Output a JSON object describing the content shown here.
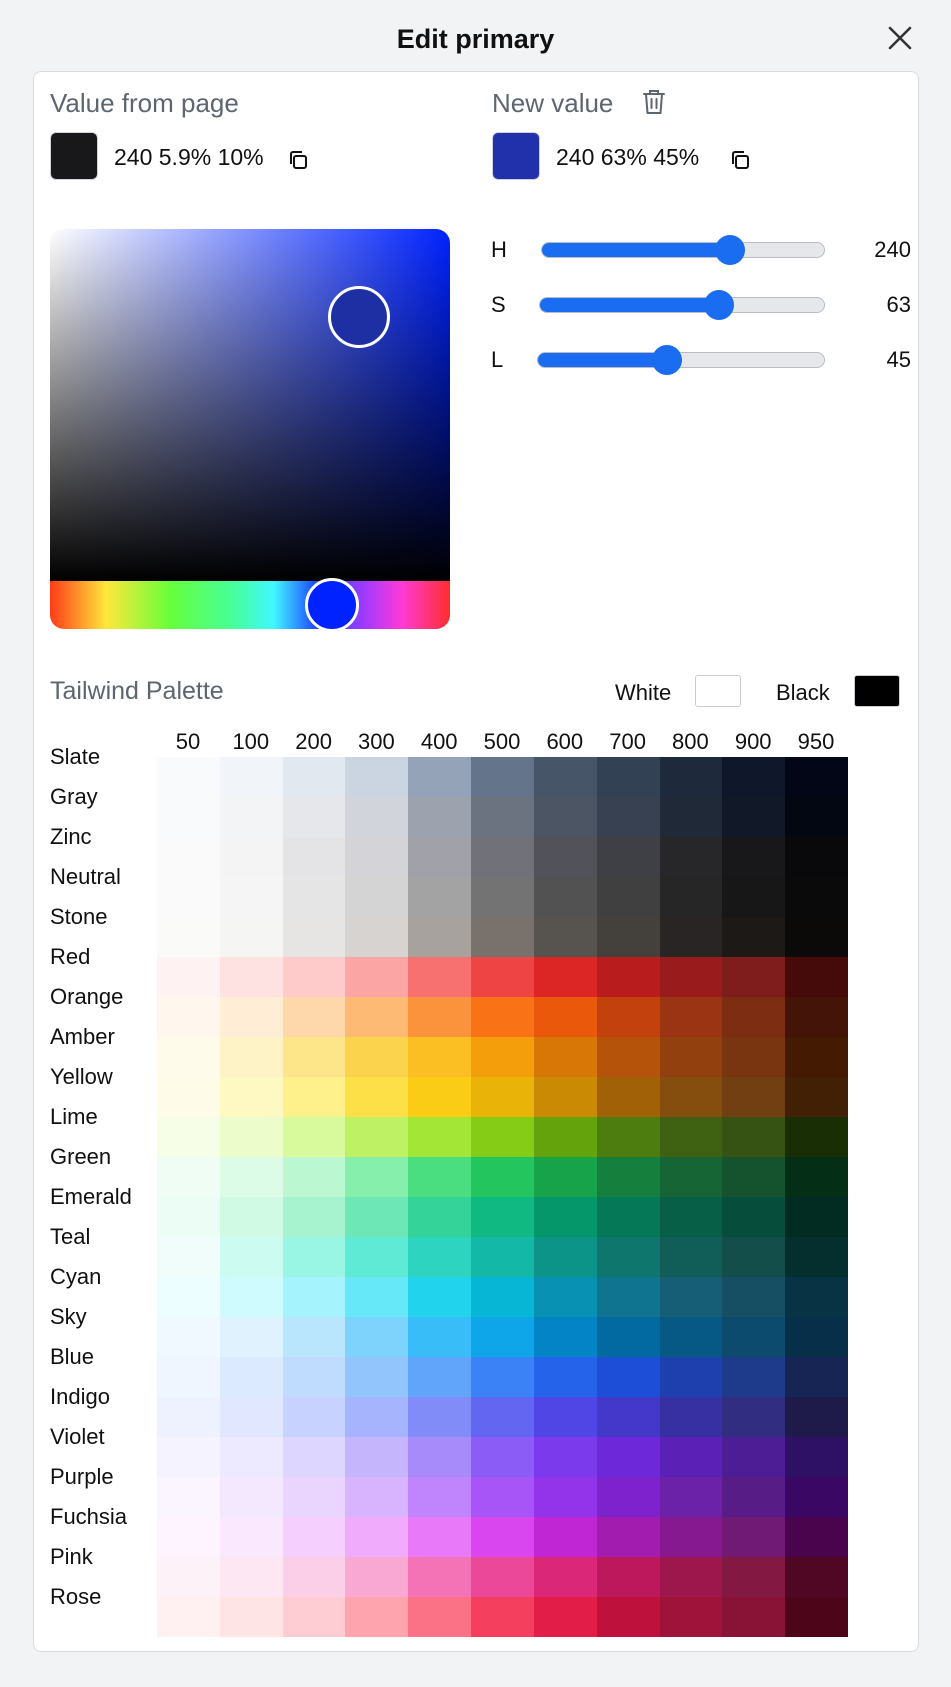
{
  "header": {
    "title": "Edit primary"
  },
  "from_page": {
    "label": "Value from page",
    "value": "240 5.9% 10%",
    "swatch": "#18181b"
  },
  "new_value": {
    "label": "New value",
    "value": "240 63% 45%",
    "swatch": "#2130ab"
  },
  "sliders": [
    {
      "letter": "H",
      "value": "240",
      "fraction": 0.667
    },
    {
      "letter": "S",
      "value": "63",
      "fraction": 0.63
    },
    {
      "letter": "L",
      "value": "45",
      "fraction": 0.45
    }
  ],
  "palette": {
    "title": "Tailwind Palette",
    "white_label": "White",
    "black_label": "Black",
    "white_color": "#ffffff",
    "black_color": "#000000",
    "shades": [
      "50",
      "100",
      "200",
      "300",
      "400",
      "500",
      "600",
      "700",
      "800",
      "900",
      "950"
    ],
    "rows": [
      {
        "name": "Slate",
        "colors": [
          "#f8fafc",
          "#f1f5f9",
          "#e2e8f0",
          "#cbd5e1",
          "#94a3b8",
          "#64748b",
          "#475569",
          "#334155",
          "#1e293b",
          "#0f172a",
          "#020617"
        ]
      },
      {
        "name": "Gray",
        "colors": [
          "#f9fafb",
          "#f3f4f6",
          "#e5e7eb",
          "#d1d5db",
          "#9ca3af",
          "#6b7280",
          "#4b5563",
          "#374151",
          "#1f2937",
          "#111827",
          "#030712"
        ]
      },
      {
        "name": "Zinc",
        "colors": [
          "#fafafa",
          "#f4f4f5",
          "#e4e4e7",
          "#d4d4d8",
          "#a1a1aa",
          "#71717a",
          "#52525b",
          "#3f3f46",
          "#27272a",
          "#18181b",
          "#09090b"
        ]
      },
      {
        "name": "Neutral",
        "colors": [
          "#fafafa",
          "#f5f5f5",
          "#e5e5e5",
          "#d4d4d4",
          "#a3a3a3",
          "#737373",
          "#525252",
          "#404040",
          "#262626",
          "#171717",
          "#0a0a0a"
        ]
      },
      {
        "name": "Stone",
        "colors": [
          "#fafaf9",
          "#f5f5f4",
          "#e7e5e4",
          "#d6d3d1",
          "#a8a29e",
          "#78716c",
          "#57534e",
          "#44403c",
          "#292524",
          "#1c1917",
          "#0c0a09"
        ]
      },
      {
        "name": "Red",
        "colors": [
          "#fef2f2",
          "#fee2e2",
          "#fecaca",
          "#fca5a5",
          "#f87171",
          "#ef4444",
          "#dc2626",
          "#b91c1c",
          "#991b1b",
          "#7f1d1d",
          "#450a0a"
        ]
      },
      {
        "name": "Orange",
        "colors": [
          "#fff7ed",
          "#ffedd5",
          "#fed7aa",
          "#fdba74",
          "#fb923c",
          "#f97316",
          "#ea580c",
          "#c2410c",
          "#9a3412",
          "#7c2d12",
          "#431407"
        ]
      },
      {
        "name": "Amber",
        "colors": [
          "#fffbeb",
          "#fef3c7",
          "#fde68a",
          "#fcd34d",
          "#fbbf24",
          "#f59e0b",
          "#d97706",
          "#b45309",
          "#92400e",
          "#78350f",
          "#451a03"
        ]
      },
      {
        "name": "Yellow",
        "colors": [
          "#fefce8",
          "#fef9c3",
          "#fef08a",
          "#fde047",
          "#facc15",
          "#eab308",
          "#ca8a04",
          "#a16207",
          "#854d0e",
          "#713f12",
          "#422006"
        ]
      },
      {
        "name": "Lime",
        "colors": [
          "#f7fee7",
          "#ecfccb",
          "#d9f99d",
          "#bef264",
          "#a3e635",
          "#84cc16",
          "#65a30d",
          "#4d7c0f",
          "#3f6212",
          "#365314",
          "#1a2e05"
        ]
      },
      {
        "name": "Green",
        "colors": [
          "#f0fdf4",
          "#dcfce7",
          "#bbf7d0",
          "#86efac",
          "#4ade80",
          "#22c55e",
          "#16a34a",
          "#15803d",
          "#166534",
          "#14532d",
          "#052e16"
        ]
      },
      {
        "name": "Emerald",
        "colors": [
          "#ecfdf5",
          "#d1fae5",
          "#a7f3d0",
          "#6ee7b7",
          "#34d399",
          "#10b981",
          "#059669",
          "#047857",
          "#065f46",
          "#064e3b",
          "#022c22"
        ]
      },
      {
        "name": "Teal",
        "colors": [
          "#f0fdfa",
          "#ccfbf1",
          "#99f6e4",
          "#5eead4",
          "#2dd4bf",
          "#14b8a6",
          "#0d9488",
          "#0f766e",
          "#115e59",
          "#134e4a",
          "#042f2e"
        ]
      },
      {
        "name": "Cyan",
        "colors": [
          "#ecfeff",
          "#cffafe",
          "#a5f3fc",
          "#67e8f9",
          "#22d3ee",
          "#06b6d4",
          "#0891b2",
          "#0e7490",
          "#155e75",
          "#164e63",
          "#083344"
        ]
      },
      {
        "name": "Sky",
        "colors": [
          "#f0f9ff",
          "#e0f2fe",
          "#bae6fd",
          "#7dd3fc",
          "#38bdf8",
          "#0ea5e9",
          "#0284c7",
          "#0369a1",
          "#075985",
          "#0c4a6e",
          "#082f49"
        ]
      },
      {
        "name": "Blue",
        "colors": [
          "#eff6ff",
          "#dbeafe",
          "#bfdbfe",
          "#93c5fd",
          "#60a5fa",
          "#3b82f6",
          "#2563eb",
          "#1d4ed8",
          "#1e40af",
          "#1e3a8a",
          "#172554"
        ]
      },
      {
        "name": "Indigo",
        "colors": [
          "#eef2ff",
          "#e0e7ff",
          "#c7d2fe",
          "#a5b4fc",
          "#818cf8",
          "#6366f1",
          "#4f46e5",
          "#4338ca",
          "#3730a3",
          "#312e81",
          "#1e1b4b"
        ]
      },
      {
        "name": "Violet",
        "colors": [
          "#f5f3ff",
          "#ede9fe",
          "#ddd6fe",
          "#c4b5fd",
          "#a78bfa",
          "#8b5cf6",
          "#7c3aed",
          "#6d28d9",
          "#5b21b6",
          "#4c1d95",
          "#2e1065"
        ]
      },
      {
        "name": "Purple",
        "colors": [
          "#faf5ff",
          "#f3e8ff",
          "#e9d5ff",
          "#d8b4fe",
          "#c084fc",
          "#a855f7",
          "#9333ea",
          "#7e22ce",
          "#6b21a8",
          "#581c87",
          "#3b0764"
        ]
      },
      {
        "name": "Fuchsia",
        "colors": [
          "#fdf4ff",
          "#fae8ff",
          "#f5d0fe",
          "#f0abfc",
          "#e879f9",
          "#d946ef",
          "#c026d3",
          "#a21caf",
          "#86198f",
          "#701a75",
          "#4a044e"
        ]
      },
      {
        "name": "Pink",
        "colors": [
          "#fdf2f8",
          "#fce7f3",
          "#fbcfe8",
          "#f9a8d4",
          "#f472b6",
          "#ec4899",
          "#db2777",
          "#be185d",
          "#9d174d",
          "#831843",
          "#500724"
        ]
      },
      {
        "name": "Rose",
        "colors": [
          "#fff1f2",
          "#ffe4e6",
          "#fecdd3",
          "#fda4af",
          "#fb7185",
          "#f43f5e",
          "#e11d48",
          "#be123c",
          "#9f1239",
          "#881337",
          "#4c0519"
        ]
      }
    ]
  }
}
